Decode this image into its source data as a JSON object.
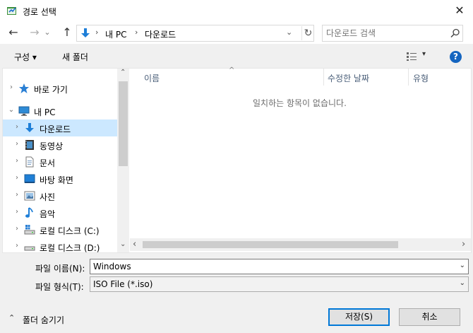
{
  "window": {
    "title": "경로 선택",
    "close_glyph": "✕"
  },
  "nav": {
    "back_glyph": "←",
    "forward_glyph": "→",
    "recent_glyph": "⌄",
    "up_glyph": "↑",
    "breadcrumb": [
      "내 PC",
      "다운로드"
    ],
    "separator": "›",
    "refresh_glyph": "↻",
    "address_dropdown_glyph": "⌄"
  },
  "search": {
    "placeholder": "다운로드 검색"
  },
  "toolbar": {
    "organize_label": "구성 ▾",
    "new_folder_label": "새 폴더",
    "view_glyph": "▾",
    "help_glyph": "?"
  },
  "tree": {
    "items": [
      {
        "label": "바로 가기",
        "icon": "star-icon",
        "expander": "›"
      },
      {
        "label": "내 PC",
        "icon": "computer-icon",
        "expander": "⌄"
      },
      {
        "label": "다운로드",
        "icon": "download-icon",
        "expander": "›",
        "selected": true
      },
      {
        "label": "동영상",
        "icon": "video-icon",
        "expander": "›"
      },
      {
        "label": "문서",
        "icon": "document-icon",
        "expander": "›"
      },
      {
        "label": "바탕 화면",
        "icon": "desktop-icon",
        "expander": "›"
      },
      {
        "label": "사진",
        "icon": "picture-icon",
        "expander": "›"
      },
      {
        "label": "음악",
        "icon": "music-icon",
        "expander": "›"
      },
      {
        "label": "로컬 디스크 (C:)",
        "icon": "drive-icon",
        "expander": "›"
      },
      {
        "label": "로컬 디스크 (D:)",
        "icon": "drive-icon",
        "expander": "›"
      }
    ],
    "scroll_up_glyph": "⌃",
    "scroll_down_glyph": "⌄"
  },
  "columns": {
    "name": "이름",
    "modified": "수정한 날짜",
    "type": "유형",
    "sort_glyph": "^"
  },
  "file_list": {
    "empty_message": "일치하는 항목이 없습니다."
  },
  "hscroll": {
    "left_glyph": "‹",
    "right_glyph": "›"
  },
  "form": {
    "filename_label": "파일 이름(N):",
    "filename_value": "Windows",
    "filetype_label": "파일 형식(T):",
    "filetype_value": "ISO File (*.iso)",
    "dropdown_glyph": "⌄"
  },
  "footer": {
    "hide_folders_label": "폴더 숨기기",
    "hide_glyph": "⌃",
    "save_label": "저장(S)",
    "cancel_label": "취소"
  },
  "colors": {
    "selection": "#cce8ff",
    "accent": "#0078d7",
    "download_arrow": "#1e7fd8",
    "help_circle": "#1565c0"
  }
}
